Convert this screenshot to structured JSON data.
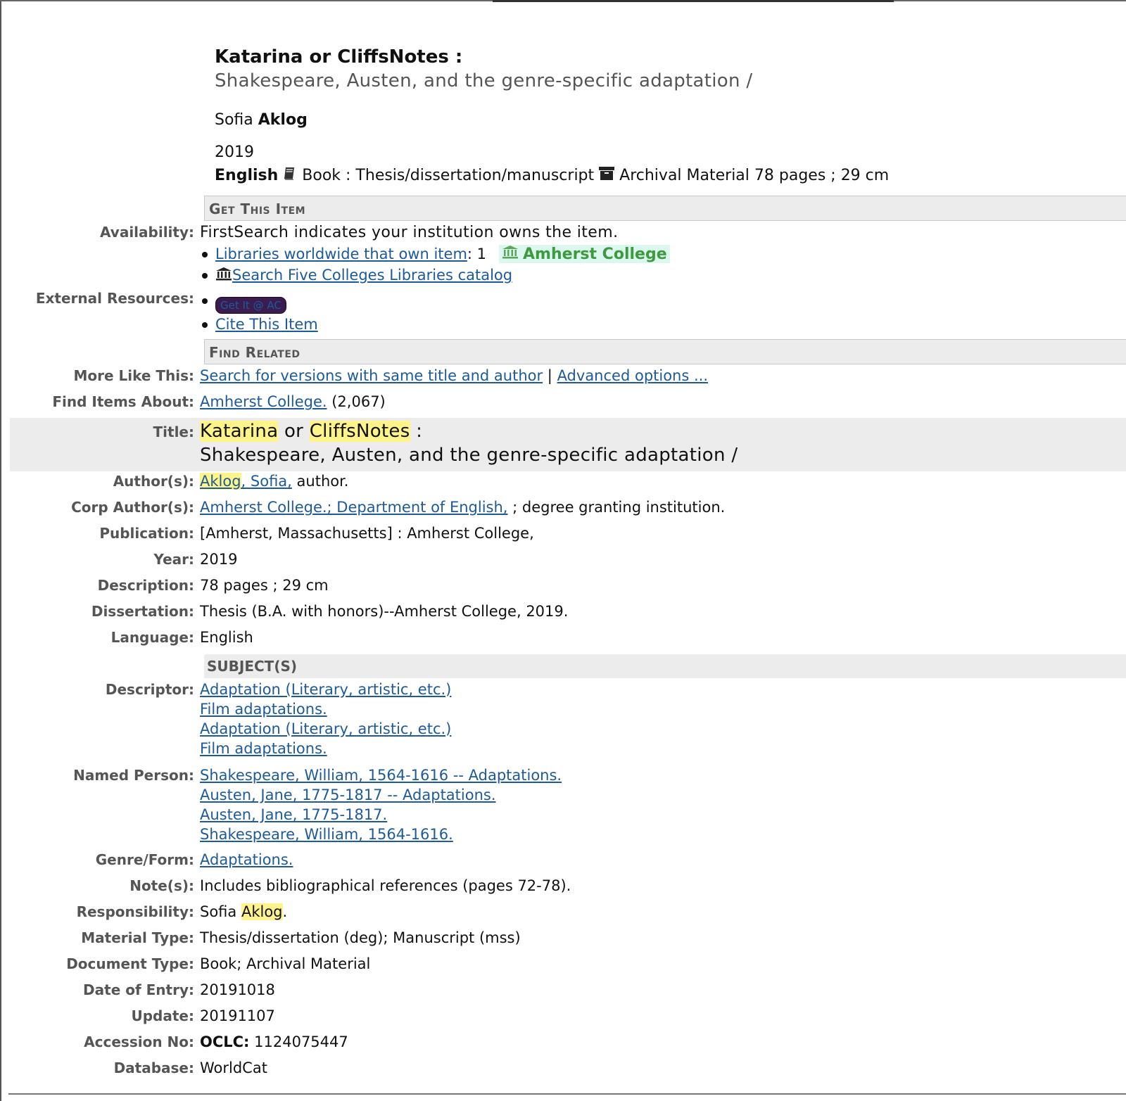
{
  "header": {
    "title": "Katarina or CliffsNotes :",
    "subtitle": "Shakespeare, Austen, and the genre-specific adaptation /",
    "author_first": "Sofia",
    "author_last": "Aklog",
    "year": "2019",
    "language": "English",
    "format_book": "Book : Thesis/dissertation/manuscript",
    "format_archival": "Archival Material 78 pages ; 29 cm"
  },
  "sections": {
    "get_this_item": "Get This Item",
    "find_related": "Find Related",
    "subjects": "SUBJECT(S)"
  },
  "availability": {
    "label": "Availability:",
    "text": "FirstSearch indicates your institution owns the item.",
    "libraries_link": "Libraries worldwide that own item",
    "libraries_count": ": 1",
    "owner": "Amherst College",
    "catalog_link": " Search Five Colleges Libraries catalog"
  },
  "external": {
    "label": "External Resources:",
    "getit": "Get It @ AC",
    "cite": "Cite This Item"
  },
  "more_like_this": {
    "label": "More Like This:",
    "link1": "Search for versions with same title and author",
    "separator": " | ",
    "link2": "Advanced options ..."
  },
  "find_items_about": {
    "label": "Find Items About:",
    "link": "Amherst College.",
    "count": " (2,067)"
  },
  "record": {
    "title_label": "Title:",
    "title_w1": "Katarina",
    "title_w2": " or ",
    "title_w3": "CliffsNotes",
    "title_w4": " :",
    "title_line2": "Shakespeare, Austen, and the genre-specific adaptation /",
    "authors_label": "Author(s):",
    "author_last": "Aklog",
    "author_first": ", Sofia,",
    "author_role": " author.",
    "corp_label": "Corp Author(s):",
    "corp_link": "Amherst College.; Department of English,",
    "corp_rest": " ; degree granting institution.",
    "publication_label": "Publication:",
    "publication": "[Amherst, Massachusetts] : Amherst College,",
    "year_label": "Year:",
    "year": "2019",
    "description_label": "Description:",
    "description": "78 pages ; 29 cm",
    "dissertation_label": "Dissertation:",
    "dissertation": "Thesis (B.A. with honors)--Amherst College, 2019.",
    "language_label": "Language:",
    "language": "English",
    "descriptor_label": "Descriptor:",
    "descriptors": [
      "Adaptation (Literary, artistic, etc.)",
      "Film adaptations.",
      "Adaptation (Literary, artistic, etc.)",
      "Film adaptations."
    ],
    "named_person_label": "Named Person:",
    "named_persons": [
      "Shakespeare, William, 1564-1616 -- Adaptations.",
      "Austen, Jane, 1775-1817 -- Adaptations.",
      "Austen, Jane, 1775-1817.",
      "Shakespeare, William, 1564-1616."
    ],
    "genre_label": "Genre/Form:",
    "genre": "Adaptations.",
    "notes_label": "Note(s):",
    "notes": "Includes bibliographical references (pages 72-78).",
    "responsibility_label": "Responsibility:",
    "responsibility_first": "Sofia ",
    "responsibility_last": "Aklog",
    "responsibility_end": ".",
    "material_label": "Material Type:",
    "material": "Thesis/dissertation (deg); Manuscript (mss)",
    "doctype_label": "Document Type:",
    "doctype": "Book; Archival Material",
    "entry_label": "Date of Entry:",
    "entry": "20191018",
    "update_label": "Update:",
    "update": "20191107",
    "accession_label": "Accession No:",
    "accession_prefix": "OCLC:",
    "accession": " 1124075447",
    "database_label": "Database:",
    "database": "WorldCat"
  },
  "colors": {
    "link": "#1d5a9b",
    "highlight": "#fff48a",
    "owner_green": "#3e9a3e",
    "section_bg": "#ececec"
  },
  "icons": [
    "book-icon",
    "archive-box-icon",
    "library-building-icon"
  ]
}
